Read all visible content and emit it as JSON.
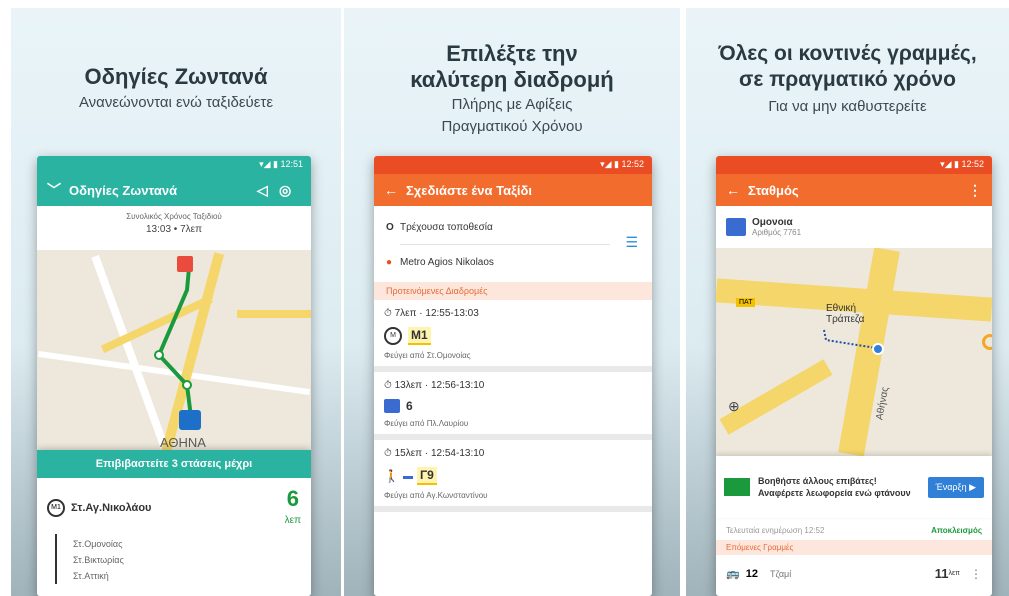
{
  "panels": [
    {
      "title": "Οδηγίες Ζωντανά",
      "subtitle": "Ανανεώνονται ενώ ταξιδεύετε",
      "phone": {
        "status_time": "12:51",
        "appbar_title": "Οδηγίες Ζωντανά",
        "trip_label": "Συνολικός Χρόνος Ταξιδιού",
        "trip_time": "13:03 • 7λεπ",
        "map_label": "ΑΘΗΝΑ",
        "instruction_title": "Επιβιβαστείτε 3 στάσεις μέχρι",
        "stop_name": "Στ.Αγ.Νικολάου",
        "minutes_value": "6",
        "minutes_unit": "λεπ",
        "line_badge": "M1",
        "stops": [
          "Στ.Ομονοίας",
          "Στ.Βικτωρίας",
          "Στ.Αττική"
        ]
      }
    },
    {
      "title_line1": "Επιλέξτε την",
      "title_line2": "καλύτερη διαδρομή",
      "subtitle_line1": "Πλήρης με Αφίξεις",
      "subtitle_line2": "Πραγματικού Χρόνου",
      "phone": {
        "status_time": "12:52",
        "appbar_title": "Σχεδιάστε ένα Ταξίδι",
        "from": "Τρέχουσα τοποθεσία",
        "to": "Metro Agios Nikolaos",
        "section_label": "Προτεινόμενες Διαδρομές",
        "routes": [
          {
            "duration": "7λεπ · 12:55-13:03",
            "line": "M1",
            "note": "Φεύγει από Στ.Ομονοίας"
          },
          {
            "duration": "13λεπ · 12:56-13:10",
            "line": "6",
            "note": "Φεύγει από Πλ.Λαυρίου"
          },
          {
            "duration": "15λεπ · 12:54-13:10",
            "line": "Γ9",
            "note": "Φεύγει από Αγ.Κωνσταντίνου"
          }
        ]
      }
    },
    {
      "title_line1": "Όλες οι κοντινές γραμμές,",
      "title_line2": "σε πραγματικό χρόνο",
      "subtitle": "Για να μην καθυστερείτε",
      "phone": {
        "status_time": "12:52",
        "appbar_title": "Σταθμός",
        "station_name": "Ομονοια",
        "station_code": "Αριθμός 7761",
        "map_label_1": "Εθνική Τράπεζα",
        "map_label_2": "ΠΑΤ",
        "map_road": "Αθήνας",
        "prompt_text": "Βοηθήστε άλλους επιβάτες! Αναφέρετε λεωφορεία ενώ φτάνουν",
        "prompt_button": "Έναρξη",
        "timing_label": "Τελευταία ενημέρωση 12:52",
        "timing_action": "Αποκλεισμός",
        "section_label": "Επόμενες Γραμμές",
        "arrival_line": "12",
        "arrival_dest": "Τζαμί",
        "arrival_time": "11",
        "arrival_unit": "λεπ"
      }
    }
  ],
  "colors": {
    "teal": "#2bb3a2",
    "orange": "#f26d2d",
    "green_route": "#1b9a3d",
    "blue_button": "#2f80d6"
  }
}
